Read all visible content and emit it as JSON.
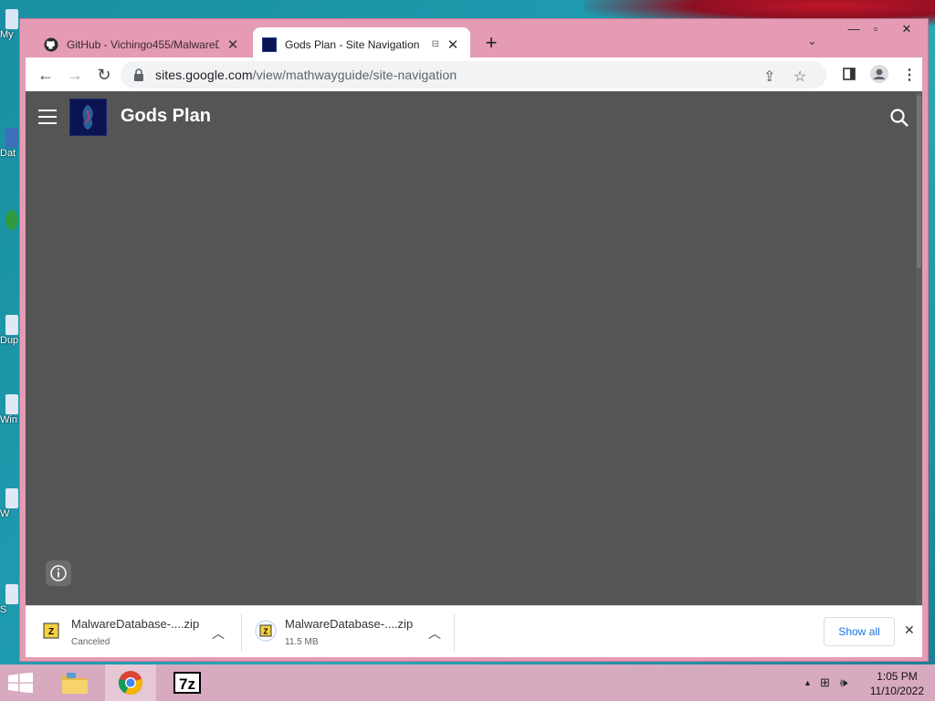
{
  "desktop": {
    "icon_labels": [
      "My",
      "Dat",
      "Dup",
      "Win",
      "W",
      "S"
    ]
  },
  "browser": {
    "tabs": [
      {
        "label": "GitHub - Vichingo455/MalwareD",
        "favicon": "github-icon"
      },
      {
        "label": "Gods Plan - Site Navigation",
        "favicon": "gods-plan-favicon",
        "active": true
      }
    ],
    "url_host": "sites.google.com",
    "url_path": "/view/mathwayguide/site-navigation"
  },
  "site": {
    "title": "Gods Plan"
  },
  "downloads": {
    "items": [
      {
        "name": "MalwareDatabase-....zip",
        "status": "Canceled"
      },
      {
        "name": "MalwareDatabase-....zip",
        "status": "11.5 MB"
      }
    ],
    "show_all_label": "Show all"
  },
  "taskbar": {
    "time": "1:05 PM",
    "date": "11/10/2022"
  },
  "colors": {
    "window_frame": "#e59bb3",
    "page_background": "#555555",
    "taskbar": "#d7aabf",
    "link_blue": "#1a73e8"
  }
}
